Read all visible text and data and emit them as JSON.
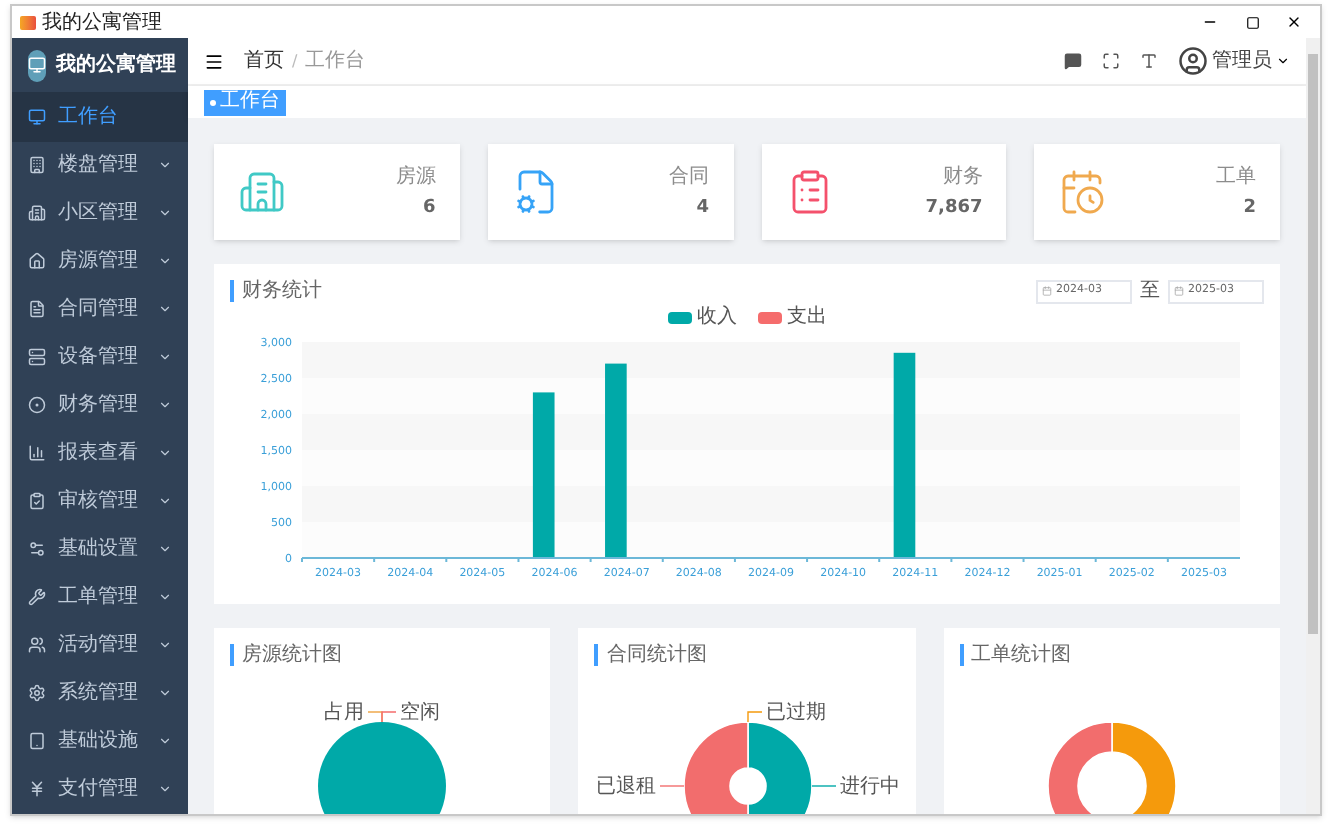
{
  "window": {
    "title": "我的公寓管理"
  },
  "sidebar": {
    "title": "我的公寓管理",
    "items": [
      {
        "label": "工作台",
        "selected": true,
        "has_submenu": false
      },
      {
        "label": "楼盘管理",
        "selected": false,
        "has_submenu": true
      },
      {
        "label": "小区管理",
        "selected": false,
        "has_submenu": true
      },
      {
        "label": "房源管理",
        "selected": false,
        "has_submenu": true
      },
      {
        "label": "合同管理",
        "selected": false,
        "has_submenu": true
      },
      {
        "label": "设备管理",
        "selected": false,
        "has_submenu": true
      },
      {
        "label": "财务管理",
        "selected": false,
        "has_submenu": true
      },
      {
        "label": "报表查看",
        "selected": false,
        "has_submenu": true
      },
      {
        "label": "审核管理",
        "selected": false,
        "has_submenu": true
      },
      {
        "label": "基础设置",
        "selected": false,
        "has_submenu": true
      },
      {
        "label": "工单管理",
        "selected": false,
        "has_submenu": true
      },
      {
        "label": "活动管理",
        "selected": false,
        "has_submenu": true
      },
      {
        "label": "系统管理",
        "selected": false,
        "has_submenu": true
      },
      {
        "label": "基础设施",
        "selected": false,
        "has_submenu": true
      },
      {
        "label": "支付管理",
        "selected": false,
        "has_submenu": true
      }
    ]
  },
  "header": {
    "breadcrumb": [
      "首页",
      "工作台"
    ],
    "breadcrumb_separator": "/",
    "user": "管理员"
  },
  "tags": [
    {
      "label": "工作台",
      "selected": true
    }
  ],
  "stats": [
    {
      "label": "房源",
      "value": "6",
      "color": "#40c9c6"
    },
    {
      "label": "合同",
      "value": "4",
      "color": "#36a3f7"
    },
    {
      "label": "财务",
      "value": "7,867",
      "color": "#f4516c"
    },
    {
      "label": "工单",
      "value": "2",
      "color": "#f0a94e"
    }
  ],
  "finance": {
    "title": "财务统计",
    "date_from": "2024-03",
    "date_separator": "至",
    "date_to": "2025-03",
    "chart_data": {
      "type": "bar",
      "categories": [
        "2024-03",
        "2024-04",
        "2024-05",
        "2024-06",
        "2024-07",
        "2024-08",
        "2024-09",
        "2024-10",
        "2024-11",
        "2024-12",
        "2025-01",
        "2025-02",
        "2025-03"
      ],
      "series": [
        {
          "name": "收入",
          "color": "#00a9a8",
          "values": [
            0,
            0,
            0,
            2300,
            2700,
            0,
            0,
            0,
            2850,
            0,
            0,
            0,
            0
          ]
        },
        {
          "name": "支出",
          "color": "#f56c6c",
          "values": [
            0,
            0,
            0,
            0,
            0,
            0,
            0,
            0,
            0,
            0,
            0,
            0,
            0
          ]
        }
      ],
      "ylim": [
        0,
        3000
      ],
      "yticks": [
        {
          "value": 0,
          "label": "0"
        },
        {
          "value": 500,
          "label": "500"
        },
        {
          "value": 1000,
          "label": "1,000"
        },
        {
          "value": 1500,
          "label": "1,500"
        },
        {
          "value": 2000,
          "label": "2,000"
        },
        {
          "value": 2500,
          "label": "2,500"
        },
        {
          "value": 3000,
          "label": "3,000"
        }
      ]
    }
  },
  "pies": [
    {
      "title": "房源统计图",
      "chart_data": {
        "type": "pie",
        "categories": [
          "占用",
          "空闲",
          null
        ],
        "values": [
          0,
          0,
          100
        ],
        "colors": [
          "#f0a94e",
          "#f56c6c",
          "#00a9a8"
        ]
      }
    },
    {
      "title": "合同统计图",
      "chart_data": {
        "type": "donut",
        "categories": [
          "进行中",
          "已退租",
          "已过期"
        ],
        "values": [
          50,
          50,
          0
        ],
        "colors": [
          "#00a9a8",
          "#f26d6d",
          "#f59a0c"
        ]
      }
    },
    {
      "title": "工单统计图",
      "chart_data": {
        "type": "donut",
        "values": [
          50,
          50
        ],
        "colors": [
          "#f59a0c",
          "#f26d6d"
        ]
      }
    }
  ]
}
